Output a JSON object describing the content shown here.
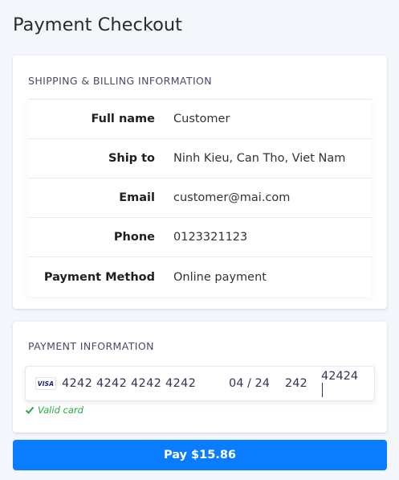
{
  "page": {
    "title": "Payment Checkout"
  },
  "shipping": {
    "section_label": "SHIPPING & BILLING INFORMATION",
    "rows": [
      {
        "key": "Full name",
        "value": "Customer"
      },
      {
        "key": "Ship to",
        "value": "Ninh Kieu, Can Tho, Viet Nam"
      },
      {
        "key": "Email",
        "value": "customer@mai.com"
      },
      {
        "key": "Phone",
        "value": "0123321123"
      },
      {
        "key": "Payment Method",
        "value": "Online payment"
      }
    ]
  },
  "payment": {
    "section_label": "PAYMENT INFORMATION",
    "card_brand": "VISA",
    "card_number": "4242 4242 4242 4242",
    "expiry": "04 / 24",
    "cvc": "242",
    "zip": "42424",
    "validation_message": "Valid card",
    "validation_color": "#27a844",
    "icons": {
      "brand": "visa-card-icon",
      "validation": "check-icon"
    }
  },
  "pay_button": {
    "label": "Pay $15.86",
    "color": "#0a7cff"
  }
}
